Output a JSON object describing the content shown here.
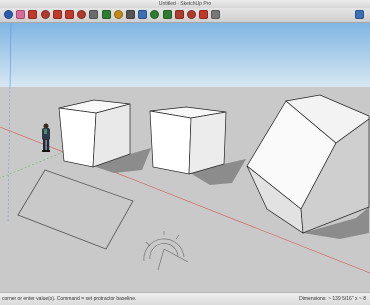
{
  "window": {
    "title": "Untitled - SketchUp Pro"
  },
  "toolbar": {
    "tools": [
      {
        "name": "select-tool-icon",
        "color": "#2a5db0"
      },
      {
        "name": "eraser-tool-icon",
        "color": "#d86b9b"
      },
      {
        "name": "paint-bucket-tool-icon",
        "color": "#c0392b"
      },
      {
        "name": "push-pull-tool-icon",
        "color": "#b03a2e"
      },
      {
        "name": "move-tool-icon",
        "color": "#c0392b"
      },
      {
        "name": "rotate-tool-icon",
        "color": "#c0392b"
      },
      {
        "name": "offset-tool-icon",
        "color": "#b03a2e"
      },
      {
        "name": "tape-measure-tool-icon",
        "color": "#6b6b6b"
      },
      {
        "name": "orbit-tool-icon",
        "color": "#2e7d32"
      },
      {
        "name": "pan-tool-icon",
        "color": "#c08a1a"
      },
      {
        "name": "zoom-tool-icon",
        "color": "#555555"
      },
      {
        "name": "zoom-extents-tool-icon",
        "color": "#3b6fb6"
      },
      {
        "name": "previous-view-tool-icon",
        "color": "#2e7d32"
      },
      {
        "name": "next-view-tool-icon",
        "color": "#2e7d32"
      },
      {
        "name": "warehouse-tool-icon",
        "color": "#b03a2e"
      },
      {
        "name": "extension-warehouse-tool-icon",
        "color": "#b03a2e"
      },
      {
        "name": "layout-tool-icon",
        "color": "#c0392b"
      },
      {
        "name": "settings-tool-icon",
        "color": "#777777"
      }
    ],
    "right_tools": [
      {
        "name": "share-model-icon",
        "color": "#3b6fb6"
      }
    ]
  },
  "statusbar": {
    "message": "corner or enter value(s). Command = set protractor baseline.",
    "dimensions_label": "Dimensions: ~ 139 5/16\" x ~ 8"
  },
  "colors": {
    "sky_top": "#7fb6e3",
    "sky_bottom": "#d7e6f1",
    "ground": "#c9c9c9",
    "red_axis": "#d06060",
    "green_axis": "#6aa86a",
    "blue_axis": "#6b8fd6"
  }
}
